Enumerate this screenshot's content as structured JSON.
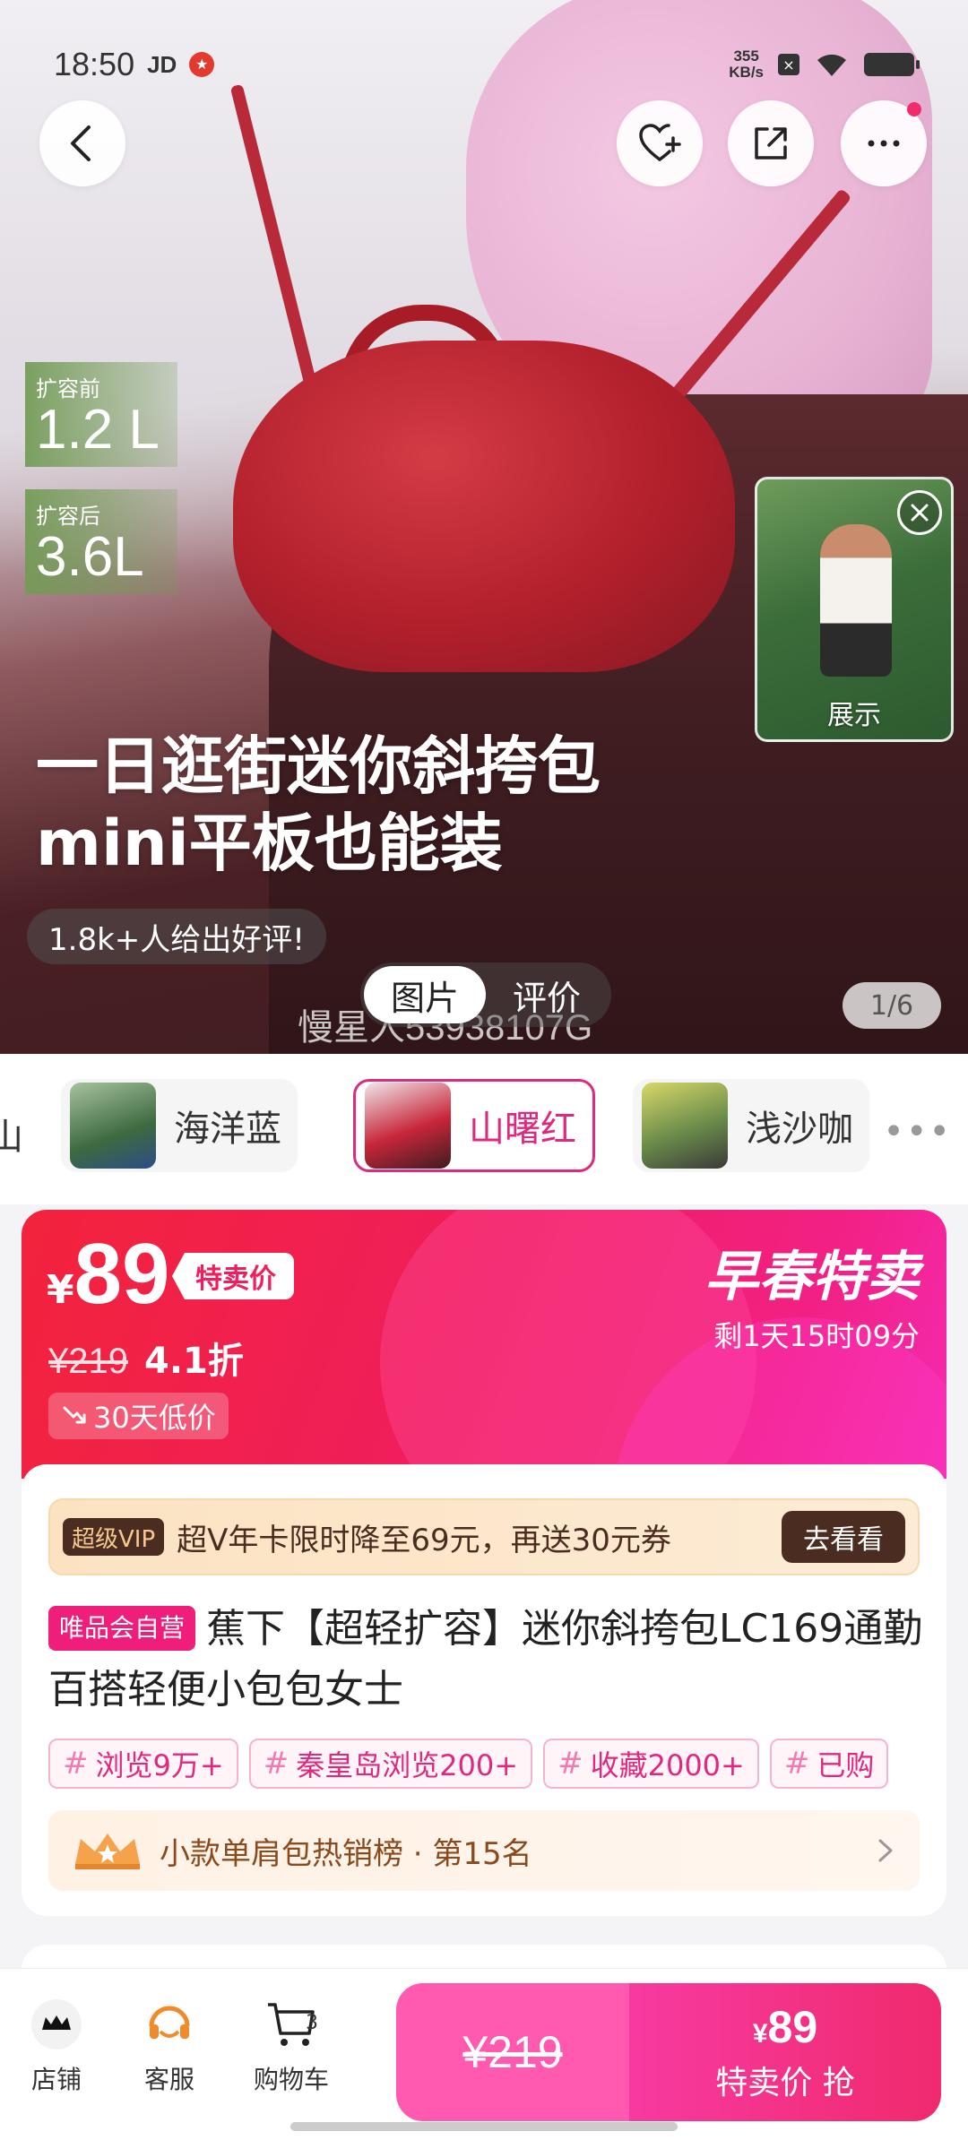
{
  "status_bar": {
    "time": "18:50",
    "carrier": "JD",
    "net_speed_value": "355",
    "net_speed_unit": "KB/s"
  },
  "hero": {
    "capacity_before_label": "扩容前",
    "capacity_before_value": "1.2 L",
    "capacity_after_label": "扩容后",
    "capacity_after_value": "3.6L",
    "headline_line1": "一日逛街迷你斜挎包",
    "headline_line2": "mini平板也能装",
    "review_pill": "1.8k+人给出好评!",
    "video_label": "展示",
    "tabs": [
      {
        "label": "图片",
        "active": true
      },
      {
        "label": "评价",
        "active": false
      }
    ],
    "watermark": "慢星人53938107G",
    "image_counter": "1/6"
  },
  "variants": {
    "items": [
      {
        "label": "海洋蓝",
        "selected": false
      },
      {
        "label": "山曙红",
        "selected": true
      },
      {
        "label": "浅沙咖",
        "selected": false
      }
    ],
    "more": "•••"
  },
  "price": {
    "currency": "¥",
    "current": "89",
    "sale_tag": "特卖价",
    "original": "¥219",
    "discount": "4.1折",
    "low_price_badge": "30天低价",
    "promo_title": "早春特卖",
    "promo_countdown": "剩1天15时09分"
  },
  "info": {
    "vip_badge": "超级VIP",
    "vip_text": "超V年卡限时降至69元，再送30元券",
    "vip_button": "去看看",
    "self_operated_tag": "唯品会自营",
    "title": "蕉下【超轻扩容】迷你斜挎包LC169通勤百搭轻便小包包女士",
    "tags": [
      "浏览9万+",
      "秦皇岛浏览200+",
      "收藏2000+",
      "已购"
    ],
    "rank_text": "小款单肩包热销榜 · 第15名"
  },
  "bottom_bar": {
    "store_label": "店铺",
    "service_label": "客服",
    "cart_label": "购物车",
    "cart_count": "3",
    "orig_price": "¥219",
    "buy_price_currency": "¥",
    "buy_price": "89",
    "buy_label": "特卖价 抢"
  },
  "colors": {
    "accent_pink": "#f01e7b",
    "price_red": "#f2233b",
    "vip_brown": "#4a2d20"
  }
}
